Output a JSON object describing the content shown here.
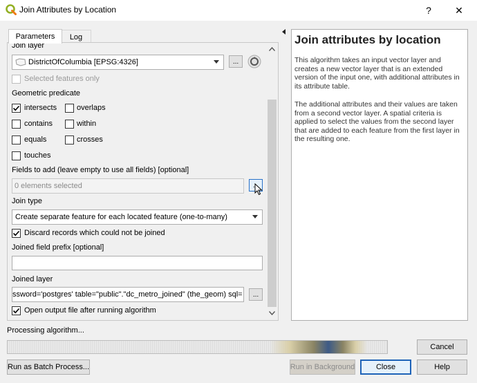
{
  "window": {
    "title": "Join Attributes by Location",
    "help_button": "?",
    "close_button": "✕"
  },
  "tabs": [
    {
      "label": "Parameters",
      "active": true
    },
    {
      "label": "Log",
      "active": false
    }
  ],
  "form": {
    "join_layer_label": "Join layer",
    "join_layer_value": "DistrictOfColumbia [EPSG:4326]",
    "join_layer_browse": "...",
    "selected_features_only": {
      "label": "Selected features only",
      "checked": false,
      "enabled": false
    },
    "geometric_predicate_label": "Geometric predicate",
    "predicates": [
      {
        "label": "intersects",
        "checked": true
      },
      {
        "label": "overlaps",
        "checked": false
      },
      {
        "label": "contains",
        "checked": false
      },
      {
        "label": "within",
        "checked": false
      },
      {
        "label": "equals",
        "checked": false
      },
      {
        "label": "crosses",
        "checked": false
      },
      {
        "label": "touches",
        "checked": false
      }
    ],
    "fields_label": "Fields to add (leave empty to use all fields) [optional]",
    "fields_value": "0 elements selected",
    "fields_browse": "...",
    "join_type_label": "Join type",
    "join_type_value": "Create separate feature for each located feature (one-to-many)",
    "discard_records": {
      "label": "Discard records which could not be joined",
      "checked": true
    },
    "prefix_label": "Joined field prefix [optional]",
    "prefix_value": "",
    "joined_layer_label": "Joined layer",
    "joined_layer_value": "ssword='postgres' table=\"public\".\"dc_metro_joined\" (the_geom) sql=",
    "joined_layer_browse": "...",
    "open_output": {
      "label": "Open output file after running algorithm",
      "checked": true
    }
  },
  "help": {
    "title": "Join attributes by location",
    "paragraph1": "This algorithm takes an input vector layer and creates a new vector layer that is an extended version of the input one, with additional attributes in its attribute table.",
    "paragraph2": "The additional attributes and their values are taken from a second vector layer. A spatial criteria is applied to select the values from the second layer that are added to each feature from the first layer in the resulting one."
  },
  "progress": {
    "label": "Processing algorithm...",
    "cancel": "Cancel"
  },
  "buttons": {
    "batch": "Run as Batch Process...",
    "background": "Run in Background",
    "close": "Close",
    "help": "Help"
  },
  "icons": {
    "app": "qgis-logo-icon",
    "layer": "polygon-layer-icon",
    "iterate": "iterate-icon"
  }
}
